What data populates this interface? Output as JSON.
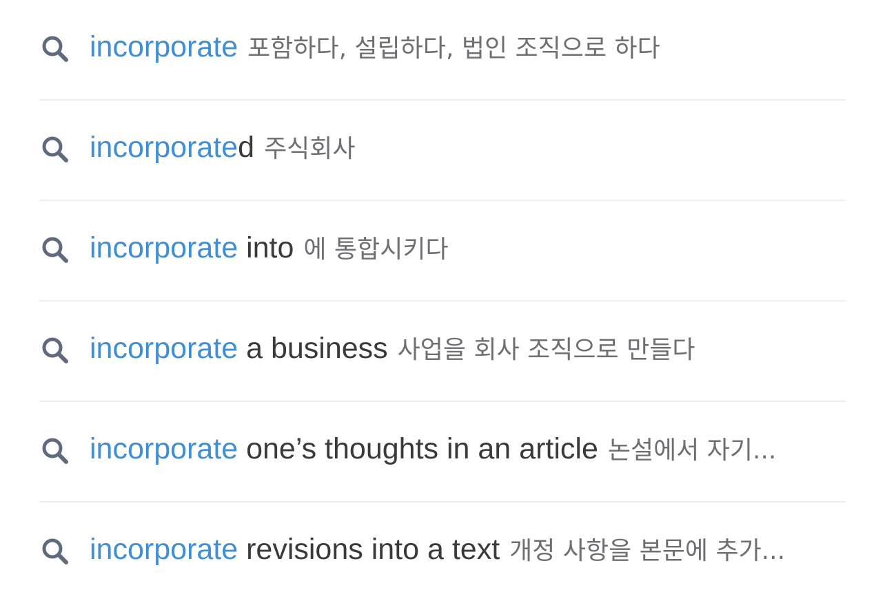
{
  "colors": {
    "match": "#3f8fd8",
    "rest": "#3a3a3c",
    "gloss": "#6e6e73",
    "icon": "#5f6a7d",
    "divider": "#efeff1"
  },
  "suggestions": [
    {
      "match": "incorporate",
      "rest": "",
      "gloss": "포함하다, 설립하다, 법인 조직으로 하다",
      "icon": "search-icon"
    },
    {
      "match": "incorporate",
      "rest": "d",
      "gloss": "주식회사",
      "icon": "search-icon"
    },
    {
      "match": "incorporate",
      "rest": " into",
      "gloss": "에 통합시키다",
      "icon": "search-icon"
    },
    {
      "match": "incorporate",
      "rest": " a business",
      "gloss": "사업을 회사 조직으로 만들다",
      "icon": "search-icon"
    },
    {
      "match": "incorporate",
      "rest": " one’s thoughts in an article",
      "gloss": "논설에서 자기...",
      "icon": "search-icon"
    },
    {
      "match": "incorporate",
      "rest": " revisions into a text",
      "gloss": "개정 사항을 본문에 추가...",
      "icon": "search-icon"
    }
  ]
}
